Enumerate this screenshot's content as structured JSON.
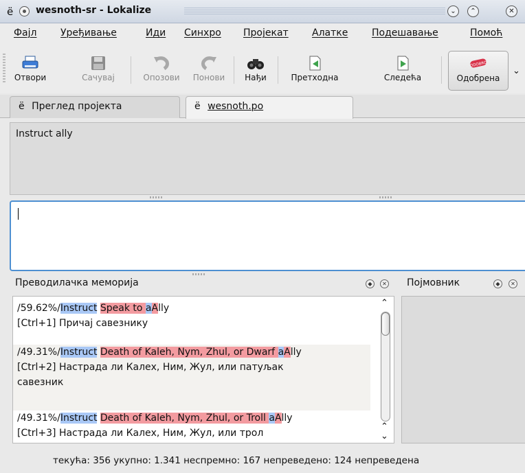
{
  "window": {
    "title": "wesnoth-sr - Lokalize",
    "app_icon": "ё",
    "buttons": {
      "minimize": "⌄",
      "maximize": "⌃",
      "close": "✕"
    }
  },
  "menu": [
    "Фајл",
    "Уређивање",
    "Иди",
    "Синхро",
    "Пројекат",
    "Алатке",
    "Подешавање",
    "Помоћ"
  ],
  "toolbar": {
    "open": "Отвори",
    "save": "Сачувај",
    "undo": "Опозови",
    "redo": "Понови",
    "find": "Нађи",
    "prev": "Претходна",
    "next": "Следећа",
    "approved": "Одобрена",
    "approved_stamp": "ODOBRO"
  },
  "tabs": [
    {
      "icon": "ё",
      "label": "Преглед пројекта"
    },
    {
      "icon": "ё",
      "label": "wesnoth.po"
    }
  ],
  "source_text": "Instruct ally",
  "target_text": "",
  "tm_panel": {
    "title": "Преводилачка меморија",
    "entries": [
      {
        "percent": "/59.62%/",
        "segments": [
          {
            "text": "Instruct",
            "hl": "b"
          },
          {
            "text": " ",
            "hl": ""
          },
          {
            "text": "Speak to ",
            "hl": "r"
          },
          {
            "text": "a",
            "hl": "b"
          },
          {
            "text": "A",
            "hl": "r"
          },
          {
            "text": "lly",
            "hl": ""
          }
        ],
        "shortcut": "[Ctrl+1]",
        "translation": "Причај савезнику"
      },
      {
        "percent": "/49.31%/",
        "segments": [
          {
            "text": "Instruct",
            "hl": "b"
          },
          {
            "text": " ",
            "hl": ""
          },
          {
            "text": "Death of Kaleh, Nym, Zhul, or Dwarf ",
            "hl": "r"
          },
          {
            "text": "a",
            "hl": "b"
          },
          {
            "text": "A",
            "hl": "r"
          },
          {
            "text": "lly",
            "hl": ""
          }
        ],
        "shortcut": "[Ctrl+2]",
        "translation": "Настрада ли Калех, Ним, Жул, или патуљак",
        "translation2": "савезник"
      },
      {
        "percent": "/49.31%/",
        "segments": [
          {
            "text": "Instruct",
            "hl": "b"
          },
          {
            "text": " ",
            "hl": ""
          },
          {
            "text": "Death of Kaleh, Nym, Zhul, or Troll ",
            "hl": "r"
          },
          {
            "text": "a",
            "hl": "b"
          },
          {
            "text": "A",
            "hl": "r"
          },
          {
            "text": "lly",
            "hl": ""
          }
        ],
        "shortcut": "[Ctrl+3]",
        "translation": "Настрада ли Калех, Ним, Жул, или трол"
      }
    ]
  },
  "glossary_panel": {
    "title": "Појмовник"
  },
  "status": "текућа: 356  укупно: 1.341  неспремно: 167  непреведено: 124  непреведена"
}
